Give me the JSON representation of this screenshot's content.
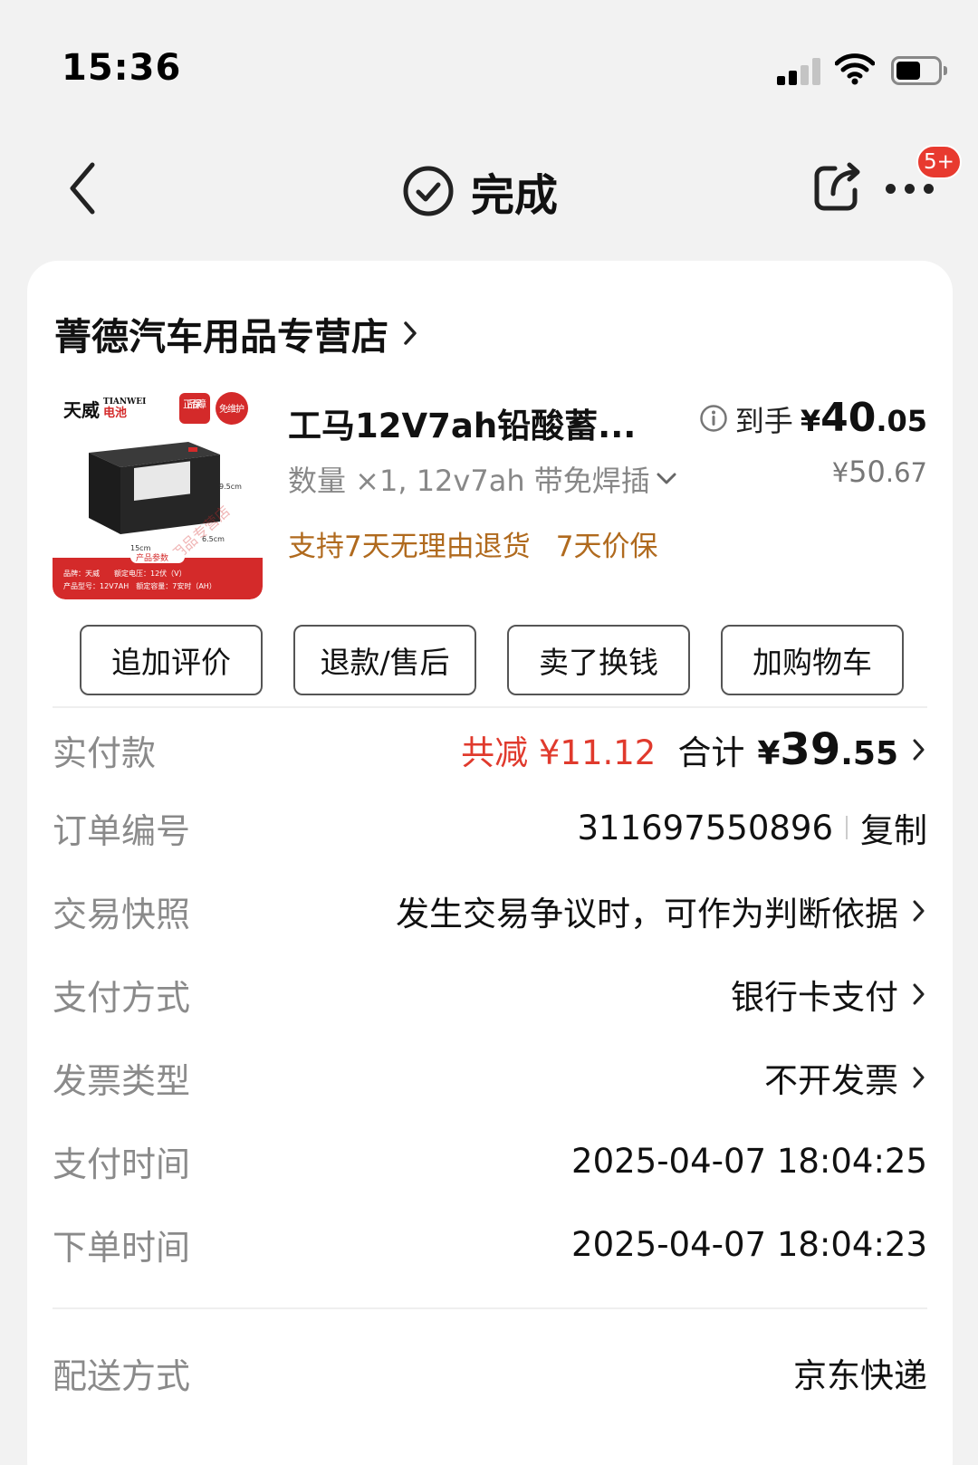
{
  "status_bar": {
    "time": "15:36"
  },
  "nav": {
    "title": "完成",
    "badge": "5+"
  },
  "shop": {
    "name": "菁德汽车用品专营店"
  },
  "product": {
    "title": "工马12V7ah铅酸蓄...",
    "spec": "数量 ×1, 12v7ah 带免焊插",
    "tags": [
      "支持7天无理由退货",
      "7天价保"
    ],
    "price_label": "到手",
    "price_symbol": "¥",
    "price_int": "40",
    "price_dec": ".05",
    "original_price_symbol": "¥",
    "original_price_int": "50",
    "original_price_dec": ".67",
    "image_text": {
      "brand": "天威",
      "brand_sub": "电池",
      "brand_en": "TIANWEI",
      "tag1": "正品保障",
      "tag2": "免维护",
      "panel_title": "产品参数",
      "line1": "品牌：天威　　额定电压：12伏（V）",
      "line2": "产品型号：12V7AH　额定容量：7安时（AH）",
      "dim1": "9.5cm",
      "dim2": "15cm",
      "dim3": "6.5cm",
      "watermark": "菁德汽车用品专营店"
    }
  },
  "actions": [
    "追加评价",
    "退款/售后",
    "卖了换钱",
    "加购物车"
  ],
  "details": {
    "paid": {
      "label": "实付款",
      "saving": "共减 ¥11.12",
      "total_label": "合计",
      "total_symbol": "¥",
      "total_int": "39",
      "total_dec": ".55"
    },
    "order_no": {
      "label": "订单编号",
      "value": "311697550896",
      "copy": "复制"
    },
    "snapshot": {
      "label": "交易快照",
      "value": "发生交易争议时，可作为判断依据"
    },
    "payment_method": {
      "label": "支付方式",
      "value": "银行卡支付"
    },
    "invoice": {
      "label": "发票类型",
      "value": "不开发票"
    },
    "pay_time": {
      "label": "支付时间",
      "value": "2025-04-07 18:04:25"
    },
    "order_time": {
      "label": "下单时间",
      "value": "2025-04-07 18:04:23"
    },
    "delivery": {
      "label": "配送方式",
      "value": "京东快递"
    }
  },
  "colors": {
    "accent_red": "#e03a2d",
    "tag_brown": "#b06a1e",
    "label_gray": "#8a8a8a"
  },
  "icons": [
    "back-chevron-icon",
    "check-circle-icon",
    "share-icon",
    "more-icon",
    "info-icon",
    "chevron-right-icon",
    "chevron-down-icon"
  ]
}
